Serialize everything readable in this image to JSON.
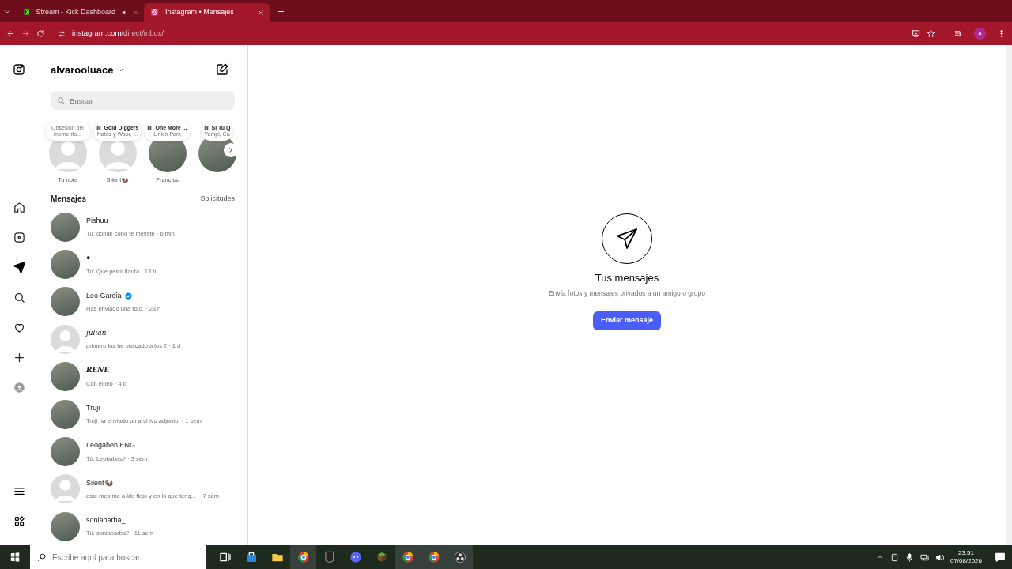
{
  "browser": {
    "tabs": [
      {
        "title": "Stream - Kick Dashboard",
        "selected": false,
        "audio": true,
        "kind": "kick"
      },
      {
        "title": "Instagram • Mensajes",
        "selected": true,
        "audio": false,
        "kind": "instagram"
      }
    ],
    "url": {
      "host": "instagram.com",
      "path": "/direct/inbox/"
    },
    "profile_initial": "a"
  },
  "sidebar": {
    "items": [
      {
        "kind": "home",
        "selected": false
      },
      {
        "kind": "reels",
        "selected": false
      },
      {
        "kind": "messages",
        "selected": true
      },
      {
        "kind": "search",
        "selected": false
      },
      {
        "kind": "heart",
        "selected": false
      },
      {
        "kind": "plus",
        "selected": false
      },
      {
        "kind": "profile",
        "selected": false
      }
    ],
    "bottom_items": [
      {
        "kind": "menu"
      },
      {
        "kind": "meta"
      }
    ]
  },
  "inbox": {
    "username": "alvarooluace",
    "search": {
      "placeholder": "Buscar"
    },
    "notes": [
      {
        "kind": "own",
        "bubble": "Obsesión del momento...",
        "name": "Tu nota",
        "has_photo": false
      },
      {
        "kind": "music",
        "title": "Gold Diggers",
        "artist": "Natos y Waor, ...",
        "name": "Silent🦦",
        "has_photo": false
      },
      {
        "kind": "music",
        "title": "One More ...",
        "artist": "Linkin Park",
        "name": "Franciss",
        "has_photo": true
      },
      {
        "kind": "music",
        "title": "Si Tu Q",
        "artist": "Yampi, Ca",
        "has_photo": true
      }
    ],
    "section_title": "Mensajes",
    "requests_link": "Solicitudes",
    "conversations": [
      {
        "name": "Pishuu",
        "preview": "Tú: donde coño te metiste · 6 min",
        "has_photo": true,
        "verified": false,
        "kind": "plain"
      },
      {
        "name": "●",
        "preview": "Tú: Que perro flauta · 13 h",
        "has_photo": true,
        "verified": false,
        "kind": "plain"
      },
      {
        "name": "Leo García",
        "preview": "Has enviado una foto. · 23 h",
        "has_photo": true,
        "verified": true,
        "kind": "plain"
      },
      {
        "name": "julian",
        "preview": "primero los he buscado a los 2 · 1 d",
        "has_photo": false,
        "verified": false,
        "kind": "script"
      },
      {
        "name": "RENE",
        "preview": "Con el leo · 4 d",
        "has_photo": true,
        "verified": false,
        "kind": "serif"
      },
      {
        "name": "Truji",
        "preview": "Truji ha enviado un archivo adjunto. · 1 sem",
        "has_photo": true,
        "verified": false,
        "kind": "plain"
      },
      {
        "name": "Leogaben ENG",
        "preview": "Tú: Leobabas? · 3 sem",
        "has_photo": true,
        "verified": false,
        "kind": "plain"
      },
      {
        "name": "Silent🦦",
        "preview": "este mes me a ido flojo y en lo que teng...  · 7 sem",
        "has_photo": false,
        "verified": false,
        "kind": "plain"
      },
      {
        "name": "soniabarba_",
        "preview": "Tú: soniabarba? · 11 sem",
        "has_photo": true,
        "verified": false,
        "kind": "plain"
      }
    ]
  },
  "empty_state": {
    "title": "Tus mensajes",
    "subtitle": "Envía fotos y mensajes privados a un amigo o grupo",
    "button": "Enviar mensaje"
  },
  "taskbar": {
    "search": {
      "placeholder": "Escribe aquí para buscar."
    },
    "apps": [
      {
        "kind": "taskview",
        "running": false
      },
      {
        "kind": "store",
        "running": false
      },
      {
        "kind": "files",
        "running": false
      },
      {
        "kind": "chrome",
        "running": true
      },
      {
        "kind": "epic",
        "running": false
      },
      {
        "kind": "discord",
        "running": false
      },
      {
        "kind": "minecraft",
        "running": false
      },
      {
        "kind": "chrome",
        "running": true
      },
      {
        "kind": "chrome",
        "running": true
      },
      {
        "kind": "obs",
        "running": true
      }
    ],
    "time": "23:51",
    "date": "07/08/2026"
  }
}
